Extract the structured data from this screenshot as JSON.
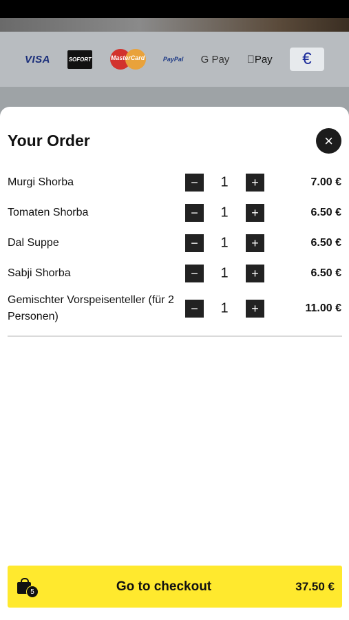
{
  "payment_methods": [
    {
      "name": "visa-icon",
      "label": "VISA"
    },
    {
      "name": "sofort-icon",
      "label": "SOFORT"
    },
    {
      "name": "mastercard-icon",
      "label": "MasterCard"
    },
    {
      "name": "paypal-icon",
      "label": "PayPal"
    },
    {
      "name": "google-pay-icon",
      "label": "G Pay"
    },
    {
      "name": "apple-pay-icon",
      "label": "Pay"
    },
    {
      "name": "euro-cash-icon",
      "label": "€"
    }
  ],
  "order": {
    "title": "Your Order",
    "close_icon": "×",
    "minus_icon": "−",
    "plus_icon": "+",
    "items": [
      {
        "name": "Murgi Shorba",
        "qty": "1",
        "price": "7.00 €"
      },
      {
        "name": "Tomaten Shorba",
        "qty": "1",
        "price": "6.50 €"
      },
      {
        "name": "Dal Suppe",
        "qty": "1",
        "price": "6.50 €"
      },
      {
        "name": "Sabji Shorba",
        "qty": "1",
        "price": "6.50 €"
      },
      {
        "name": "Gemischter Vorspeisenteller (für 2 Personen)",
        "qty": "1",
        "price": "11.00 €"
      }
    ]
  },
  "checkout": {
    "label": "Go to checkout",
    "total": "37.50 €",
    "item_count": "5"
  },
  "colors": {
    "accent": "#ffe92e",
    "dark": "#222222"
  }
}
